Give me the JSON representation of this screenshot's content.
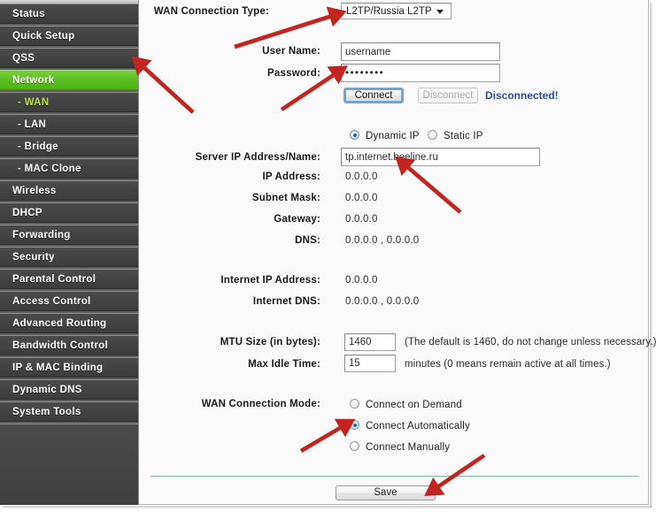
{
  "sidebar": {
    "items": [
      {
        "label": "Status",
        "type": "main",
        "active": false
      },
      {
        "label": "Quick Setup",
        "type": "main",
        "active": false
      },
      {
        "label": "QSS",
        "type": "main",
        "active": false
      },
      {
        "label": "Network",
        "type": "main",
        "active": true
      },
      {
        "label": "- WAN",
        "type": "sub",
        "active": true
      },
      {
        "label": "- LAN",
        "type": "sub",
        "active": false
      },
      {
        "label": "- Bridge",
        "type": "sub",
        "active": false
      },
      {
        "label": "- MAC Clone",
        "type": "sub",
        "active": false
      },
      {
        "label": "Wireless",
        "type": "main",
        "active": false
      },
      {
        "label": "DHCP",
        "type": "main",
        "active": false
      },
      {
        "label": "Forwarding",
        "type": "main",
        "active": false
      },
      {
        "label": "Security",
        "type": "main",
        "active": false
      },
      {
        "label": "Parental Control",
        "type": "main",
        "active": false
      },
      {
        "label": "Access Control",
        "type": "main",
        "active": false
      },
      {
        "label": "Advanced Routing",
        "type": "main",
        "active": false
      },
      {
        "label": "Bandwidth Control",
        "type": "main",
        "active": false
      },
      {
        "label": "IP & MAC Binding",
        "type": "main",
        "active": false
      },
      {
        "label": "Dynamic DNS",
        "type": "main",
        "active": false
      },
      {
        "label": "System Tools",
        "type": "main",
        "active": false
      }
    ],
    "colors": {
      "active_green": "#5cbe22",
      "sub_active_text": "#b9e02f",
      "row_bg": "#434343"
    }
  },
  "form": {
    "wan_connection_type": {
      "label": "WAN Connection Type:",
      "value": "L2TP/Russia L2TP",
      "options": [
        "L2TP/Russia L2TP"
      ]
    },
    "user_name": {
      "label": "User Name:",
      "value": "username",
      "placeholder": ""
    },
    "password": {
      "label": "Password:",
      "value": "••••••••",
      "placeholder": ""
    },
    "connect_button": "Connect",
    "disconnect_button": "Disconnect",
    "connection_status": "Disconnected!",
    "connection_status_color": "#2b4ea0",
    "ip_mode": {
      "options": [
        {
          "label": "Dynamic IP",
          "checked": true
        },
        {
          "label": "Static IP",
          "checked": false
        }
      ]
    },
    "server_ip": {
      "label": "Server IP Address/Name:",
      "value": "tp.internet.beeline.ru",
      "placeholder": ""
    },
    "readonly_fields": [
      {
        "label": "IP Address:",
        "value": "0.0.0.0"
      },
      {
        "label": "Subnet Mask:",
        "value": "0.0.0.0"
      },
      {
        "label": "Gateway:",
        "value": "0.0.0.0"
      },
      {
        "label": "DNS:",
        "value": "0.0.0.0 , 0.0.0.0"
      }
    ],
    "internet_fields": [
      {
        "label": "Internet IP Address:",
        "value": "0.0.0.0"
      },
      {
        "label": "Internet DNS:",
        "value": "0.0.0.0 , 0.0.0.0"
      }
    ],
    "mtu": {
      "label": "MTU Size (in bytes):",
      "value": "1460",
      "note": "(The default is 1460, do not change unless necessary.)"
    },
    "max_idle": {
      "label": "Max Idle Time:",
      "value": "15",
      "note": "minutes (0 means remain active at all times.)"
    },
    "wan_mode": {
      "label": "WAN Connection Mode:",
      "options": [
        {
          "label": "Connect on Demand",
          "checked": false
        },
        {
          "label": "Connect Automatically",
          "checked": true
        },
        {
          "label": "Connect Manually",
          "checked": false
        }
      ]
    },
    "save_button": "Save"
  },
  "annotations": {
    "arrow_color": "#c2241f",
    "count": 5
  }
}
